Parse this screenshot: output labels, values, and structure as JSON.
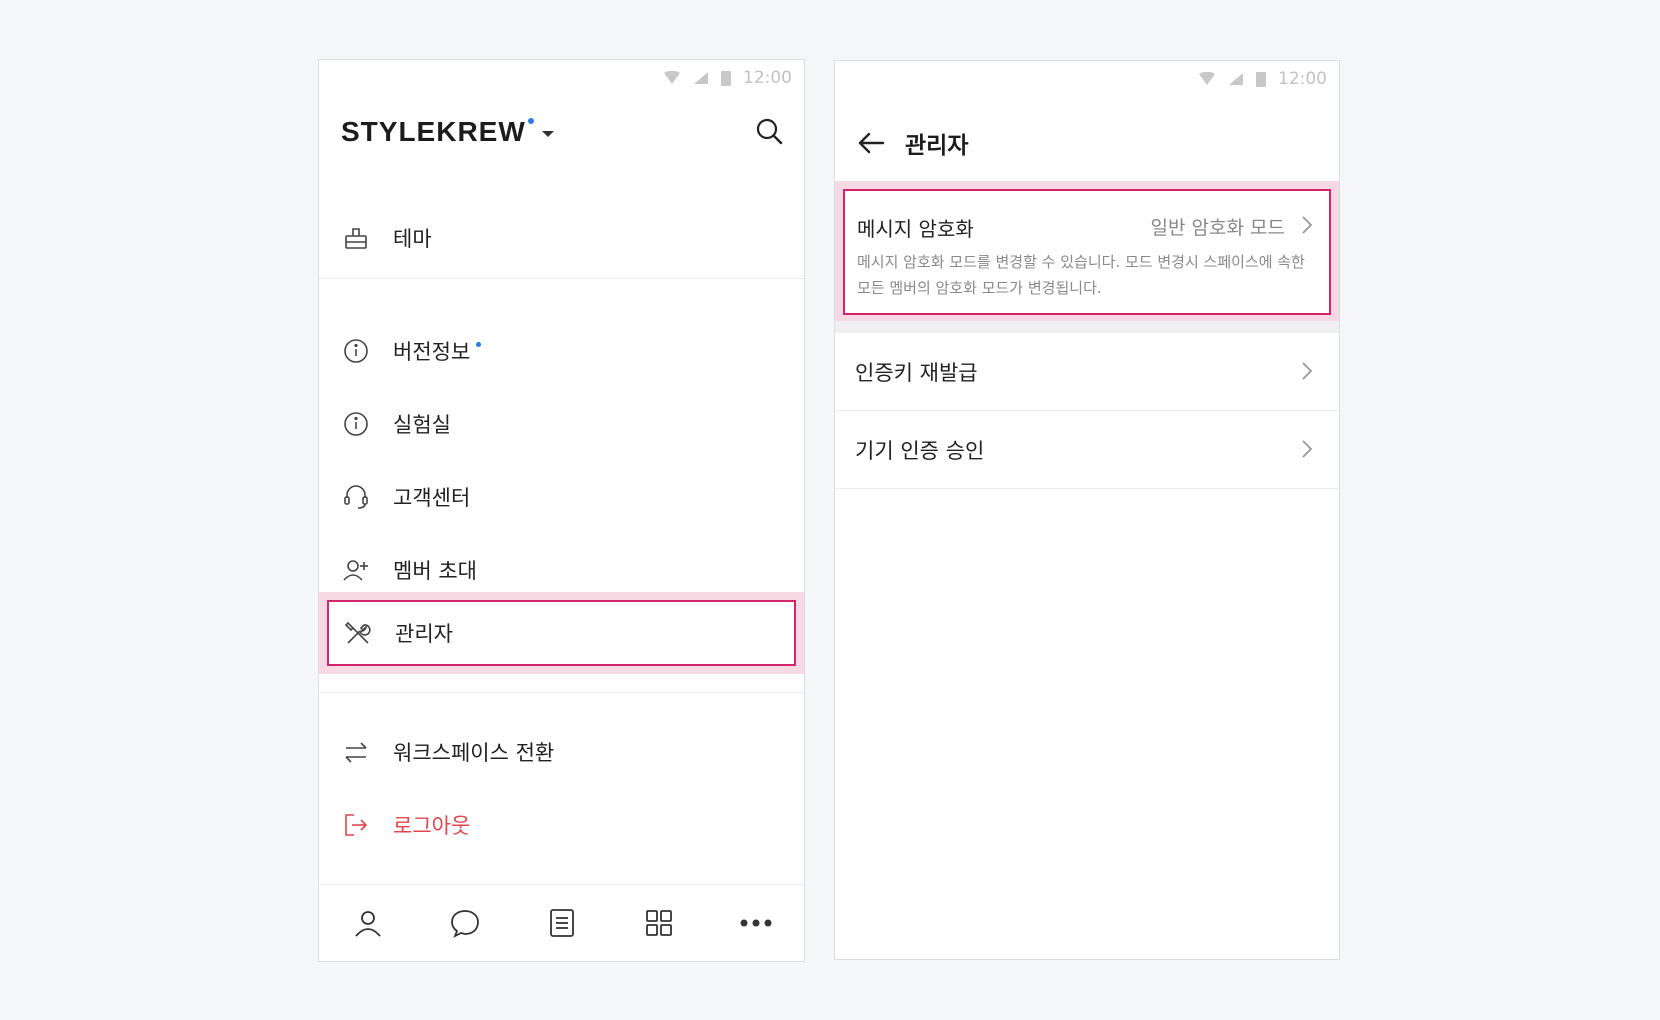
{
  "status_bar": {
    "time": "12:00"
  },
  "left": {
    "brand": {
      "logo": "STYLEKREW",
      "dot_color": "#2c7be5"
    },
    "menu": {
      "theme": "테마",
      "version": "버전정보",
      "lab": "실험실",
      "support": "고객센터",
      "invite": "멤버 초대",
      "admin": "관리자",
      "switch_workspace": "워크스페이스 전환",
      "logout": "로그아웃"
    },
    "tabs": [
      "profile-icon",
      "chat-icon",
      "document-icon",
      "apps-icon",
      "more-icon"
    ]
  },
  "right": {
    "title": "관리자",
    "encryption": {
      "title": "메시지 암호화",
      "value": "일반 암호화 모드",
      "description": "메시지 암호화 모드를 변경할 수 있습니다. 모드 변경시 스페이스에 속한 모든 멤버의 암호화 모드가 변경됩니다."
    },
    "reissue_key": "인증키 재발급",
    "device_approval": "기기 인증 승인"
  },
  "colors": {
    "highlight_border": "#d4256b",
    "highlight_bg": "#f7d9e4",
    "logout": "#e0464e",
    "accent": "#2c7be5"
  }
}
